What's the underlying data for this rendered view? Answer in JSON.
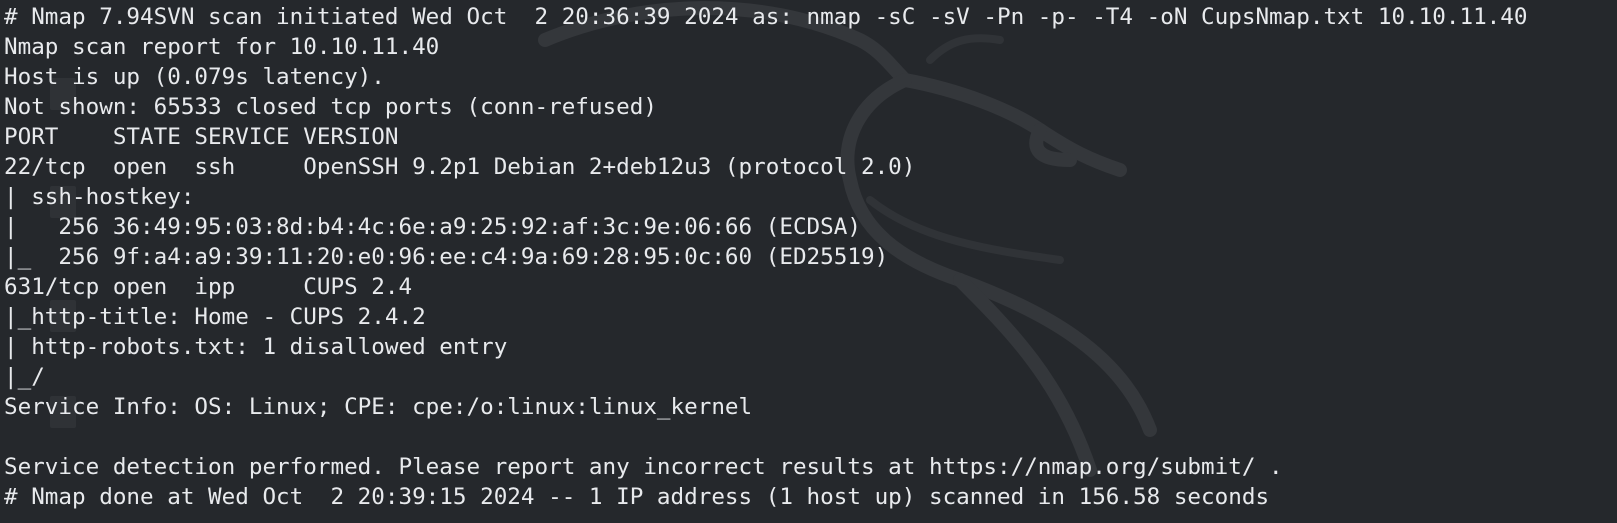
{
  "terminal": {
    "lines": [
      "# Nmap 7.94SVN scan initiated Wed Oct  2 20:36:39 2024 as: nmap -sC -sV -Pn -p- -T4 -oN CupsNmap.txt 10.10.11.40",
      "Nmap scan report for 10.10.11.40",
      "Host is up (0.079s latency).",
      "Not shown: 65533 closed tcp ports (conn-refused)",
      "PORT    STATE SERVICE VERSION",
      "22/tcp  open  ssh     OpenSSH 9.2p1 Debian 2+deb12u3 (protocol 2.0)",
      "| ssh-hostkey: ",
      "|   256 36:49:95:03:8d:b4:4c:6e:a9:25:92:af:3c:9e:06:66 (ECDSA)",
      "|_  256 9f:a4:a9:39:11:20:e0:96:ee:c4:9a:69:28:95:0c:60 (ED25519)",
      "631/tcp open  ipp     CUPS 2.4",
      "|_http-title: Home - CUPS 2.4.2",
      "| http-robots.txt: 1 disallowed entry ",
      "|_/",
      "Service Info: OS: Linux; CPE: cpe:/o:linux:linux_kernel",
      "",
      "Service detection performed. Please report any incorrect results at https://nmap.org/submit/ .",
      "# Nmap done at Wed Oct  2 20:39:15 2024 -- 1 IP address (1 host up) scanned in 156.58 seconds"
    ]
  },
  "colors": {
    "background": "#25282c",
    "text": "#e8eaed",
    "watermark": "#3a3d41"
  },
  "background": {
    "watermark_icon": "kali-dragon-icon"
  }
}
